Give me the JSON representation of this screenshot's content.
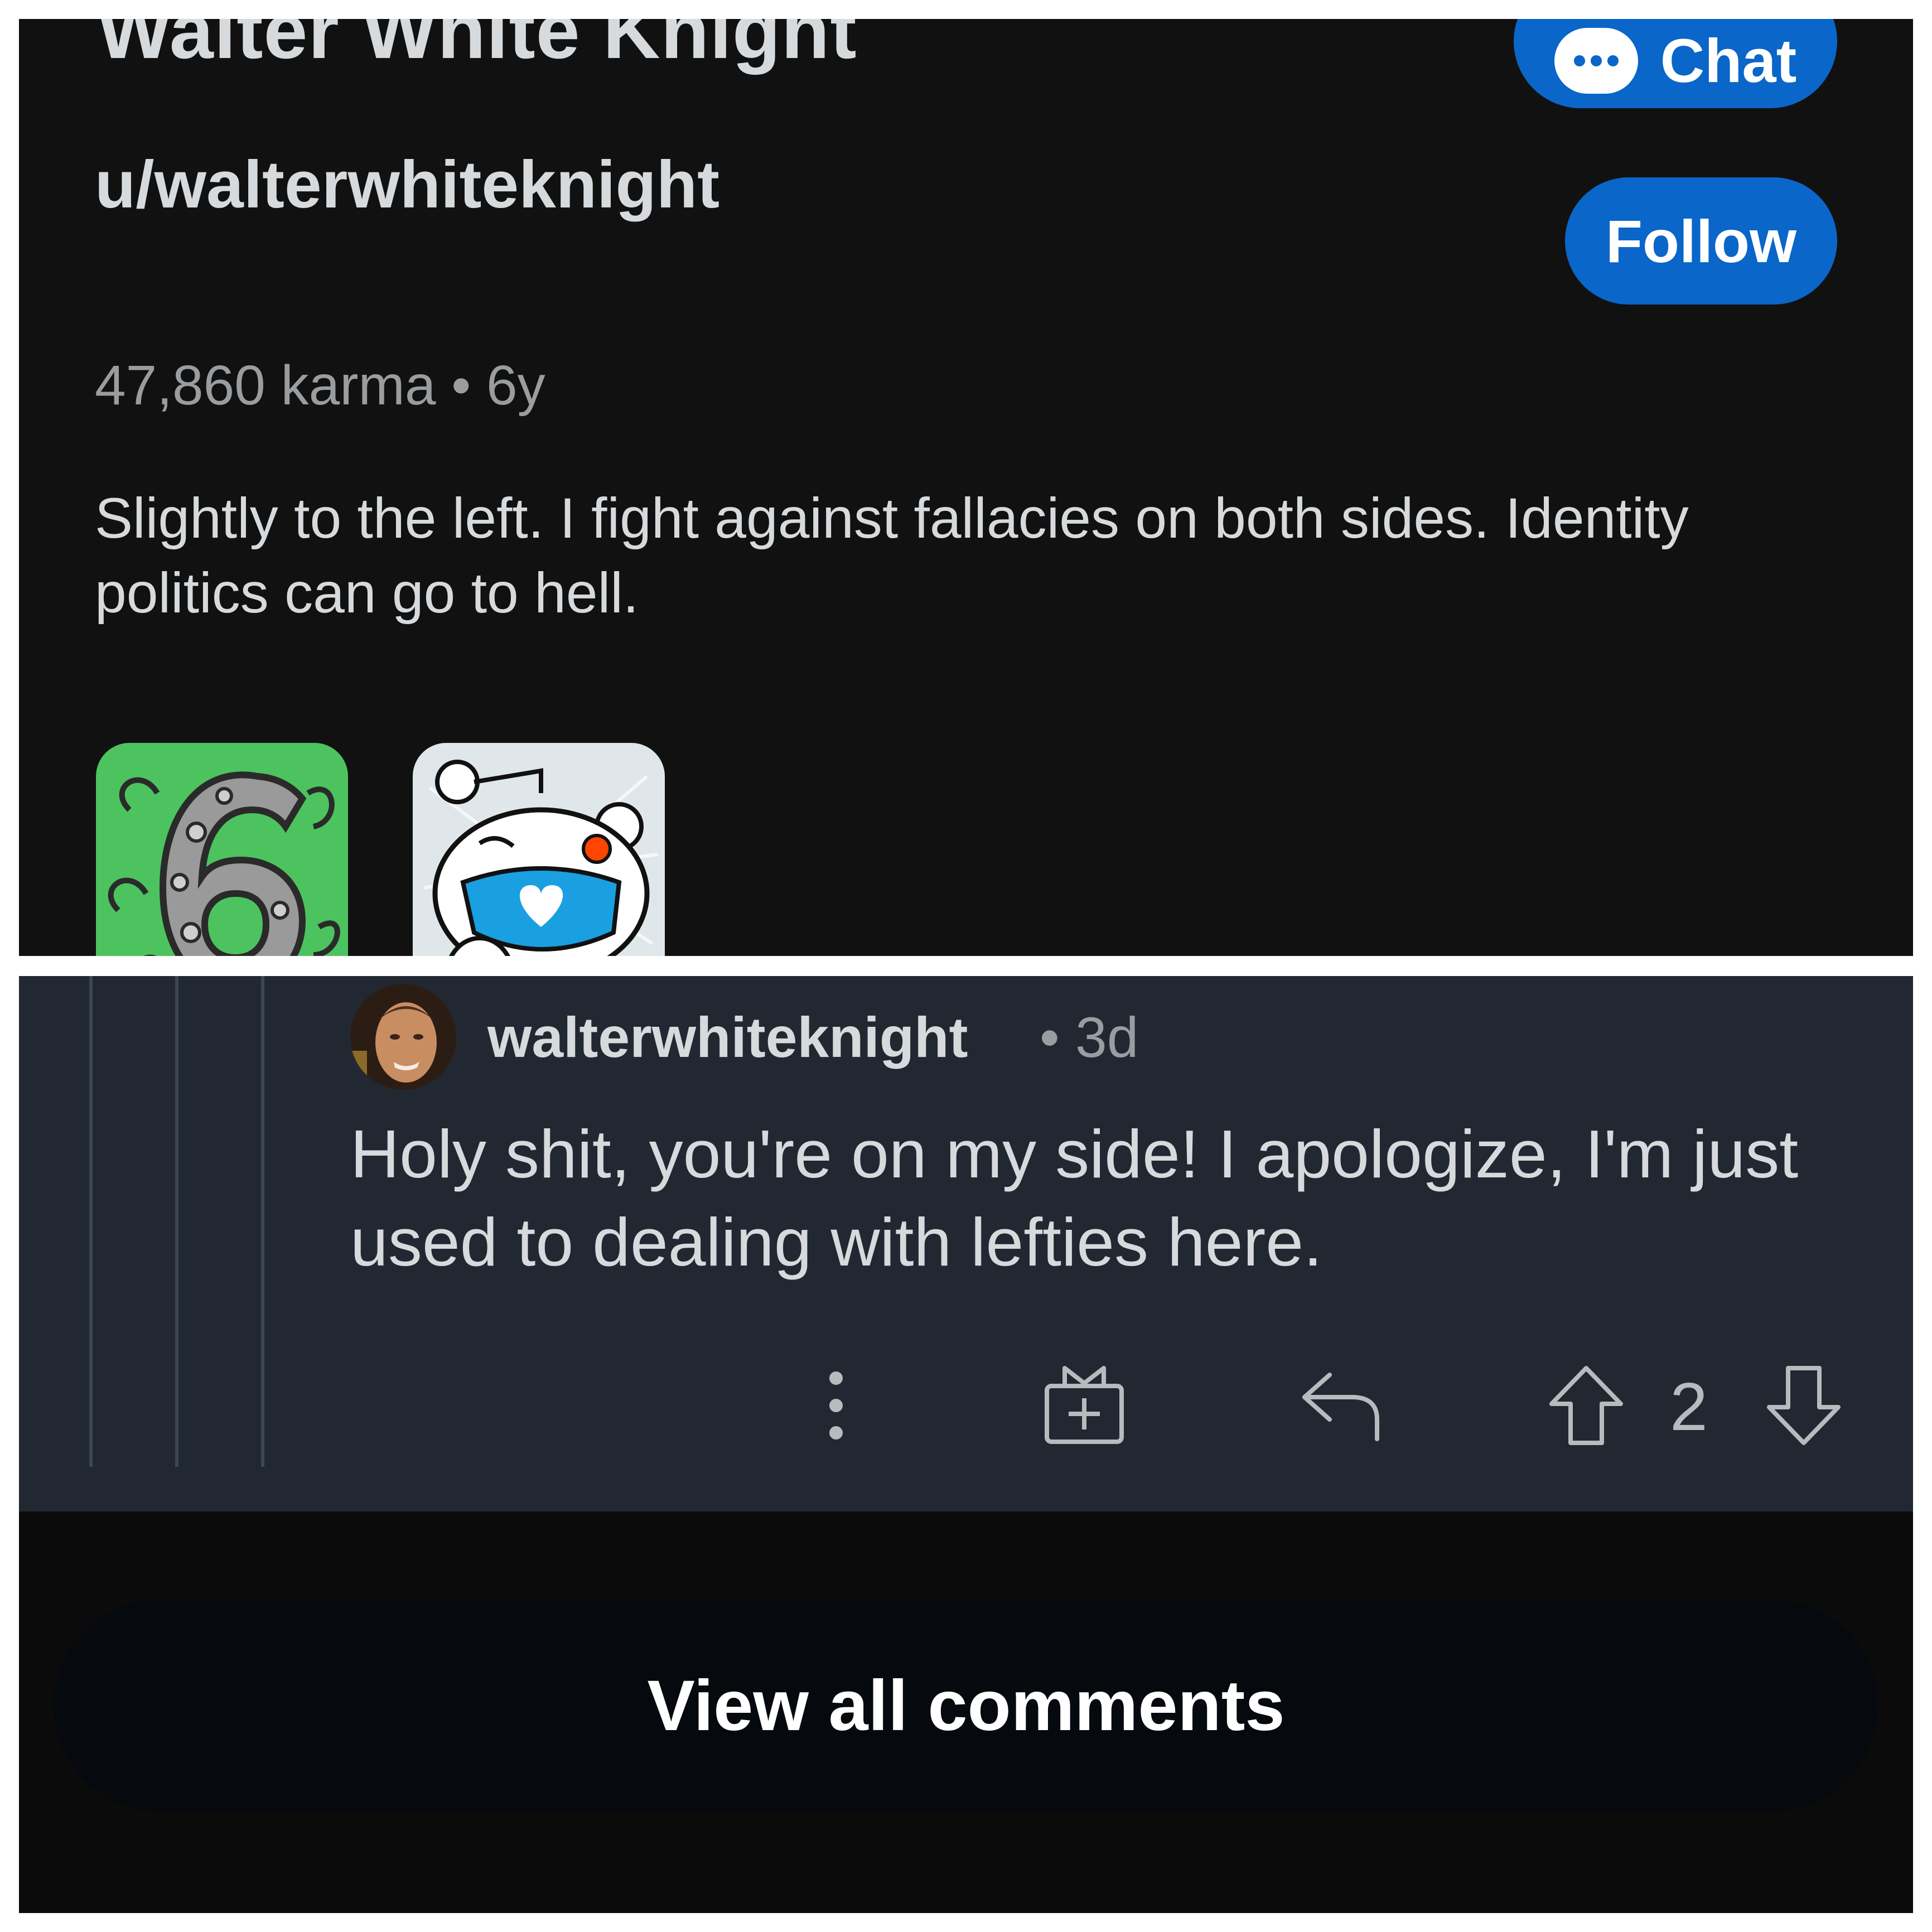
{
  "profile": {
    "display_name": "Walter White Knight",
    "username": "u/walterwhiteknight",
    "karma_line": "47,860 karma • 6y",
    "bio": "Slightly to the left. I fight against fallacies on both sides. Identity politics can go to hell.",
    "chat_label": "Chat",
    "follow_label": "Follow",
    "trophies": [
      "six-year-club-icon",
      "snoo-mask-heart-icon"
    ]
  },
  "comment": {
    "author": "walterwhiteknight",
    "age": "• 3d",
    "body": "Holy shit, you're on my side! I apologize, I'm just used to dealing with lefties here.",
    "vote_count": "2"
  },
  "footer": {
    "view_all_label": "View all comments"
  },
  "colors": {
    "accent_blue": "#0a66c8",
    "profile_bg": "#111111",
    "comment_bg": "#222831",
    "footer_bg": "#0b0b0b"
  }
}
